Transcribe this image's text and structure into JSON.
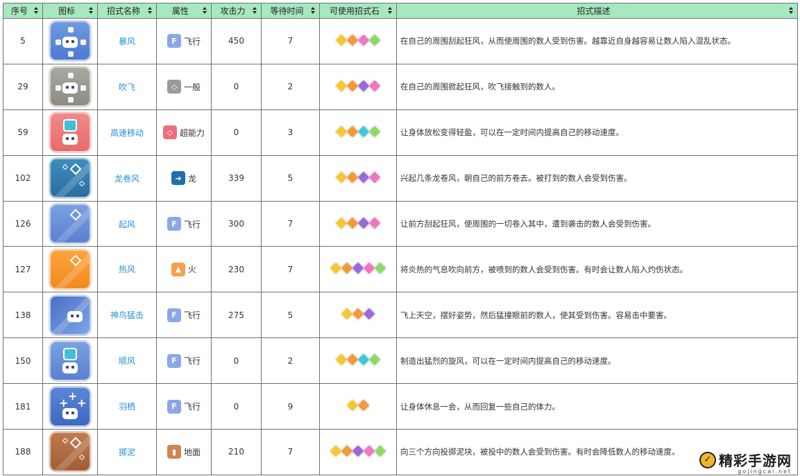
{
  "columns": [
    "序号",
    "图标",
    "招式名称",
    "属性",
    "攻击力",
    "等待时间",
    "可使用招式石",
    "招式描述"
  ],
  "colors": {
    "header_bg": "#a6e8c0",
    "link": "#2a8fd8",
    "stone_yellow": "#f0c83a",
    "stone_orange": "#f39a3d",
    "stone_purple": "#9c6ad8",
    "stone_pink": "#ec78c0",
    "stone_cyan": "#3ec8d8",
    "stone_green": "#8ed86a"
  },
  "rows": [
    {
      "no": "5",
      "name": "暴风",
      "attr": "飞行",
      "attack": "450",
      "wait": "7",
      "desc": "在自己的周围刮起狂风，从而使周围的数人受到伤害。越靠近自身越容易让数人陷入混乱状态。"
    },
    {
      "no": "29",
      "name": "吹飞",
      "attr": "一般",
      "attack": "0",
      "wait": "2",
      "desc": "在自己的周围掀起狂风，吹飞接触到的数人。"
    },
    {
      "no": "59",
      "name": "高速移动",
      "attr": "超能力",
      "attack": "0",
      "wait": "3",
      "desc": "让身体放松变得轻盈，可以在一定时间内提高自己的移动速度。"
    },
    {
      "no": "102",
      "name": "龙卷风",
      "attr": "龙",
      "attack": "339",
      "wait": "5",
      "desc": "兴起几条龙卷风，朝自己的前方卷去。被打到的数人会受到伤害。"
    },
    {
      "no": "126",
      "name": "起风",
      "attr": "飞行",
      "attack": "300",
      "wait": "7",
      "desc": "让前方刮起狂风，使周围的一切卷入其中，遭到袭击的数人会受到伤害。"
    },
    {
      "no": "127",
      "name": "热风",
      "attr": "火",
      "attack": "230",
      "wait": "7",
      "desc": "将炎热的气息吹向前方，被喷到的数人会受到伤害。有时会让数人陷入灼伤状态。"
    },
    {
      "no": "138",
      "name": "神鸟猛击",
      "attr": "飞行",
      "attack": "275",
      "wait": "5",
      "desc": "飞上天空，摆好姿势，然后猛撞眼前的数人，使其受到伤害。容易击中要害。"
    },
    {
      "no": "150",
      "name": "顺风",
      "attr": "飞行",
      "attack": "0",
      "wait": "2",
      "desc": "制造出猛烈的旋风，可以在一定时间内提高自己的移动速度。"
    },
    {
      "no": "181",
      "name": "羽栖",
      "attr": "飞行",
      "attack": "0",
      "wait": "9",
      "desc": "让身体休息一会，从而回复一些自己的体力。"
    },
    {
      "no": "188",
      "name": "掷泥",
      "attr": "地面",
      "attack": "210",
      "wait": "7",
      "desc": "向三个方向投掷泥块，被投中的数人会受到伤害。有时会降低数人的移动速度。"
    }
  ],
  "watermark": {
    "title": "精彩手游网",
    "url": "gojingcai.net"
  }
}
